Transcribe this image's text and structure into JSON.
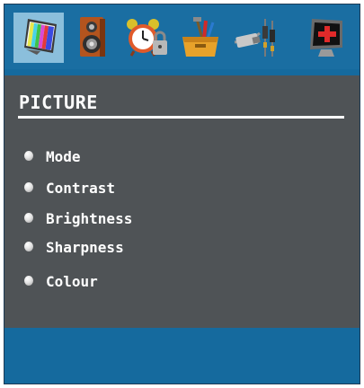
{
  "tabs": [
    {
      "icon": "tv-picture-icon",
      "active": true
    },
    {
      "icon": "speaker-icon",
      "active": false
    },
    {
      "icon": "alarm-clock-lock-icon",
      "active": false
    },
    {
      "icon": "toolbox-icon",
      "active": false
    },
    {
      "icon": "connector-cable-icon",
      "active": false
    },
    {
      "icon": "monitor-source-icon",
      "active": false
    }
  ],
  "panel": {
    "title": "PICTURE",
    "items": [
      {
        "label": "Mode"
      },
      {
        "label": "Contrast"
      },
      {
        "label": "Brightness"
      },
      {
        "label": "Sharpness"
      },
      {
        "label": "Colour"
      }
    ]
  },
  "colors": {
    "bar": "#1a6ea2",
    "active_tab": "#8bbfdc",
    "panel": "#4f5356",
    "text": "#ffffff"
  }
}
